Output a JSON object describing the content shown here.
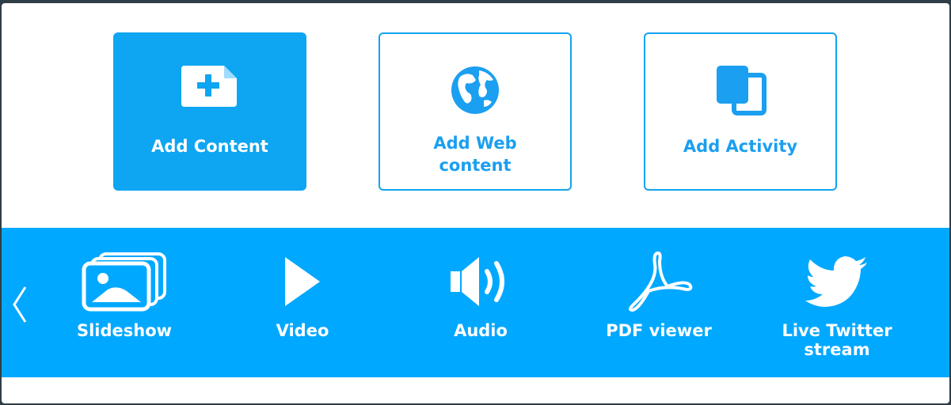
{
  "cards": {
    "add_content": {
      "label": "Add Content",
      "icon": "add-file-icon"
    },
    "add_web": {
      "label": "Add Web\ncontent",
      "icon": "globe-icon"
    },
    "add_activity": {
      "label": "Add Activity",
      "icon": "activity-copy-icon"
    }
  },
  "tools": {
    "prev_icon": "chevron-left-icon",
    "items": [
      {
        "label": "Slideshow",
        "icon": "slideshow-icon"
      },
      {
        "label": "Video",
        "icon": "play-icon"
      },
      {
        "label": "Audio",
        "icon": "speaker-icon"
      },
      {
        "label": "PDF viewer",
        "icon": "pdf-icon"
      },
      {
        "label": "Live Twitter\nstream",
        "icon": "twitter-bird-icon"
      }
    ]
  },
  "colors": {
    "accent": "#0ea5f2",
    "strip": "#00a8ff",
    "panel": "#ffffff",
    "backdrop": "#2f3d47"
  }
}
